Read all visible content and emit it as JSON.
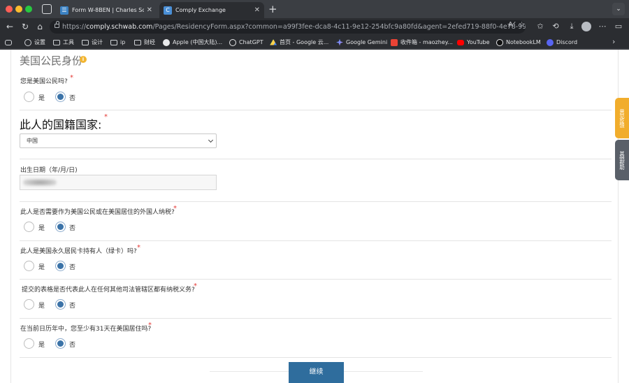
{
  "browser": {
    "tabs": [
      {
        "title": "Form W-8BEN | Charles Schwab",
        "favicon": "schwab-favicon",
        "active": false
      },
      {
        "title": "Comply Exchange",
        "favicon": "comply-favicon",
        "active": true
      }
    ],
    "address": {
      "scheme": "https://",
      "host": "comply.schwab.com",
      "path": "/Pages/ResidencyForm.aspx?common=a99f3fee-dca8-4c11-9e12-254bfc9a80fd&agent=2efed719-88f0-4e78-9939-b25e..."
    },
    "bookmarks": [
      {
        "label": "设置",
        "icon": "gear-icon"
      },
      {
        "label": "工具",
        "icon": "folder-icon"
      },
      {
        "label": "设计",
        "icon": "folder-icon"
      },
      {
        "label": "ip",
        "icon": "folder-icon"
      },
      {
        "label": "财经",
        "icon": "folder-icon"
      },
      {
        "label": "Apple (中国大陆)...",
        "icon": "apple-icon"
      },
      {
        "label": "ChatGPT",
        "icon": "chatgpt-icon"
      },
      {
        "label": "首页 - Google 云...",
        "icon": "google-drive-icon"
      },
      {
        "label": "Google Gemini",
        "icon": "gemini-icon"
      },
      {
        "label": "收件箱 - maozhey...",
        "icon": "gmail-icon"
      },
      {
        "label": "YouTube",
        "icon": "youtube-icon"
      },
      {
        "label": "NotebookLM",
        "icon": "notebooklm-icon"
      },
      {
        "label": "Discord",
        "icon": "discord-icon"
      }
    ]
  },
  "form": {
    "section_title": "美国公民身份",
    "q_us_citizen": {
      "label": "您是美国公民吗?",
      "yes": "是",
      "no": "否",
      "selected": "no"
    },
    "q_country": {
      "label": "此人的国籍国家:",
      "selected_value": "中国"
    },
    "q_birth_date": {
      "label": "出生日期（年/月/日)",
      "value_hidden": true
    },
    "q_us_tax_resident": {
      "label": "此人是否需要作为美国公民或在美国居住的外国人纳税?",
      "yes": "是",
      "no": "否",
      "selected": "no"
    },
    "q_green_card": {
      "label": "此人是美国永久居民卡持有人（绿卡）吗?",
      "yes": "是",
      "no": "否",
      "selected": "no"
    },
    "q_other_jurisdiction": {
      "label": "提交的表格是否代表此人在任何其他司法管辖区都有纳税义务?",
      "yes": "是",
      "no": "否",
      "selected": "no"
    },
    "q_31_days": {
      "label": "在当前日历年中，您至少有31天在美国居住吗?",
      "yes": "是",
      "no": "否",
      "selected": "no"
    },
    "required_mark": "*",
    "continue_label": "继续"
  },
  "side_tabs": {
    "tab1": "意见反馈",
    "tab2": "其他帮助"
  },
  "colors": {
    "primary": "#2f6d9d",
    "radio_selected": "#3b73a8",
    "required": "#e53935",
    "info": "#f2b531",
    "side_tab_1": "#f1ad2c",
    "side_tab_2": "#5a6069"
  }
}
